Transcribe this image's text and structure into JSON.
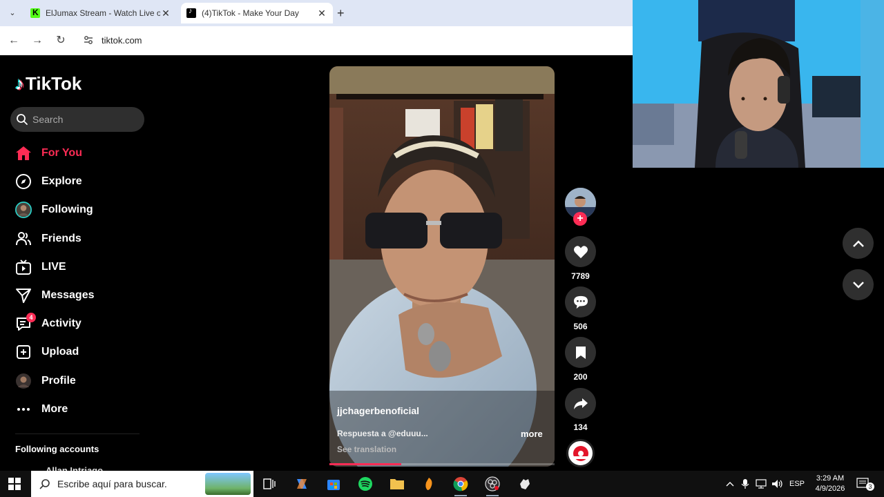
{
  "browser": {
    "tabs": [
      {
        "title": "ElJumax Stream - Watch Live on",
        "close": "✕"
      },
      {
        "title": "(4)TikTok - Make Your Day",
        "close": "✕"
      }
    ],
    "new_tab": "+",
    "url": "tiktok.com"
  },
  "tiktok": {
    "logo": "TikTok",
    "search_placeholder": "Search",
    "nav": [
      {
        "label": "For You",
        "icon": "home-icon",
        "active": true
      },
      {
        "label": "Explore",
        "icon": "compass-icon"
      },
      {
        "label": "Following",
        "icon": "following-avatar-icon"
      },
      {
        "label": "Friends",
        "icon": "friends-icon"
      },
      {
        "label": "LIVE",
        "icon": "live-tv-icon"
      },
      {
        "label": "Messages",
        "icon": "send-icon"
      },
      {
        "label": "Activity",
        "icon": "activity-icon",
        "badge": "4"
      },
      {
        "label": "Upload",
        "icon": "upload-plus-icon"
      },
      {
        "label": "Profile",
        "icon": "profile-avatar-icon"
      },
      {
        "label": "More",
        "icon": "more-dots-icon"
      }
    ],
    "following_accounts_title": "Following accounts",
    "following_accounts": [
      "Allan Intriago"
    ],
    "video": {
      "username": "jjchagerbenoficial",
      "description": "Respuesta a @eduuu...",
      "more": "more",
      "see_translation": "See translation",
      "progress": 0.32
    },
    "actions": {
      "likes": "7789",
      "comments": "506",
      "saves": "200",
      "shares": "134"
    }
  },
  "taskbar": {
    "search_placeholder": "Escribe aquí para buscar.",
    "language": "ESP",
    "time": "3:29 AM",
    "date": "4/9/2026",
    "notifications": "3"
  },
  "colors": {
    "accent": "#fe2c55",
    "bg": "#000000",
    "button_bg": "#2f2f2f"
  }
}
